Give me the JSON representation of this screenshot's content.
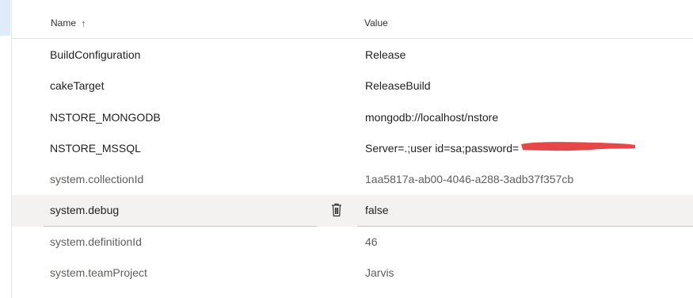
{
  "header": {
    "name_label": "Name",
    "sort_indicator": "↑",
    "value_label": "Value"
  },
  "variables": [
    {
      "name": "BuildConfiguration",
      "value": "Release"
    },
    {
      "name": "cakeTarget",
      "value": "ReleaseBuild"
    },
    {
      "name": "NSTORE_MONGODB",
      "value": "mongodb://localhost/nstore"
    },
    {
      "name": "NSTORE_MSSQL",
      "value": "Server=.;user id=sa;password="
    },
    {
      "name": "system.collectionId",
      "value": "1aa5817a-ab00-4046-a288-3adb37f357cb"
    },
    {
      "name": "system.debug",
      "value": "false"
    },
    {
      "name": "system.definitionId",
      "value": "46"
    },
    {
      "name": "system.teamProject",
      "value": "Jarvis"
    }
  ],
  "colors": {
    "redaction": "#e8474a",
    "selected_accent": "#deecf9",
    "hover_row": "#f3f2f1"
  },
  "icons": {
    "delete": "trash-icon"
  }
}
